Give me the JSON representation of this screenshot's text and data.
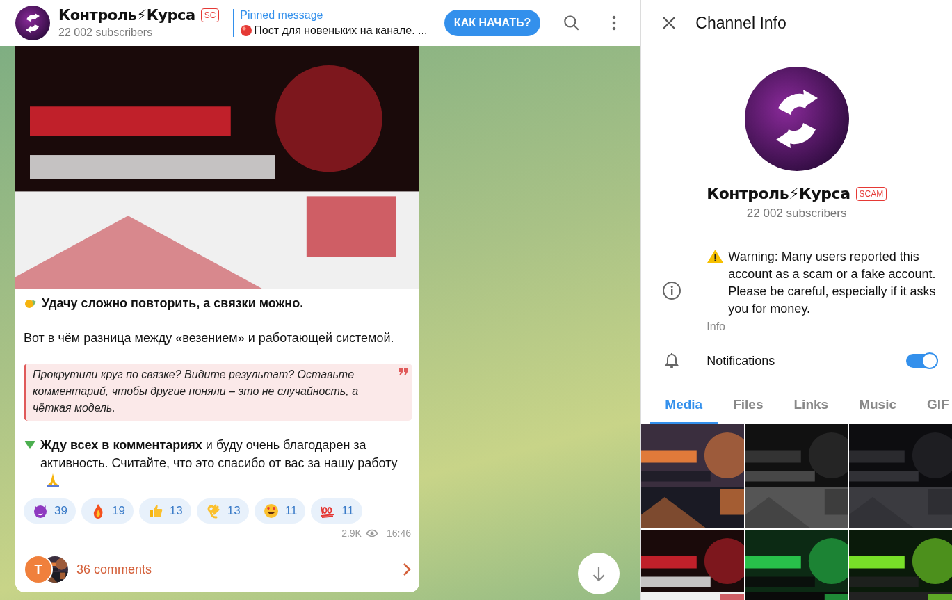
{
  "header": {
    "channel_name": "Контроль⚡Курса",
    "badge": "SC",
    "subscribers": "22 002 subscribers",
    "pinned": {
      "label": "Pinned message",
      "text": "Пост для новеньких на канале. ..."
    },
    "action_button": "КАК НАЧАТЬ?"
  },
  "message": {
    "paragraphs": [
      {
        "kind": "lead",
        "text": "Удачу сложно повторить, а связки можно."
      },
      {
        "kind": "link_text",
        "text": "Вот в чём разница между «везением» и ",
        "link": "работающей системой",
        "after": "."
      },
      {
        "kind": "quote",
        "text": "Прокрутили круг по связке? Видите результат? Оставьте комментарий, чтобы другие поняли – это не случайность, а чёткая модель."
      },
      {
        "kind": "callout",
        "text": "**Жду всех в комментариях** и буду очень благодарен за активность. Считайте, что это спасибо от вас за нашу работу"
      }
    ],
    "reactions": [
      {
        "kind": "devil",
        "count": "39"
      },
      {
        "kind": "fire",
        "count": "19"
      },
      {
        "kind": "thumbs",
        "count": "13"
      },
      {
        "kind": "ok",
        "count": "13"
      },
      {
        "kind": "heart_eyes",
        "count": "11"
      },
      {
        "kind": "hundred",
        "count": "11"
      }
    ],
    "views": "2.9K",
    "time": "16:46",
    "comments": {
      "avatar_letter": "T",
      "label": "36 comments"
    }
  },
  "channel_info": {
    "title": "Channel Info",
    "name": "Контроль⚡Курса",
    "badge": "SCAM",
    "subscribers": "22 002 subscribers",
    "info": {
      "text": "Warning: Many users reported this account as a scam or a fake account. Please be careful, especially if it asks you for money.",
      "label": "Info"
    },
    "notifications": {
      "label": "Notifications",
      "on": true
    },
    "tabs": [
      {
        "label": "Media",
        "selected": true
      },
      {
        "label": "Files",
        "selected": false
      },
      {
        "label": "Links",
        "selected": false
      },
      {
        "label": "Music",
        "selected": false
      },
      {
        "label": "GIF",
        "selected": false
      }
    ]
  }
}
